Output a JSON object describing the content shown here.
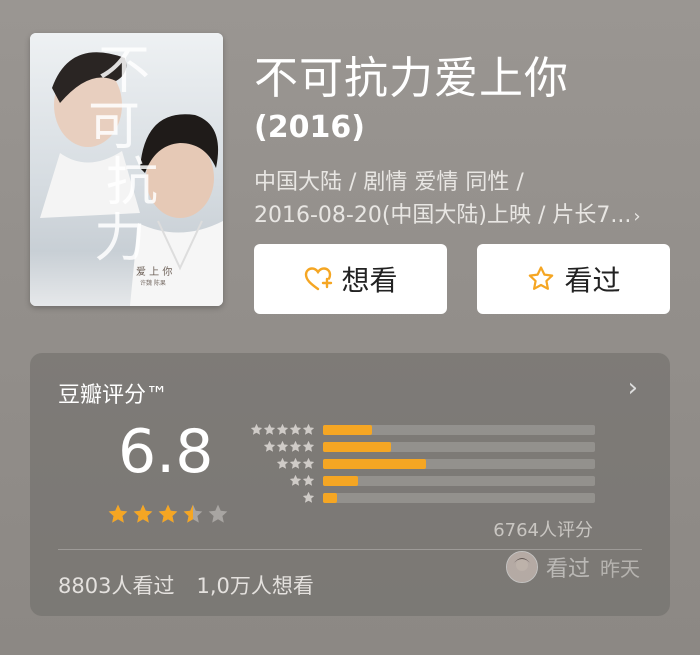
{
  "movie": {
    "title": "不可抗力爱上你",
    "year": "(2016)",
    "meta_line1": "中国大陆 / 剧情 爱情 同性 /",
    "meta_line2": "2016-08-20(中国大陆)上映 / 片长7...",
    "meta_chevron": "›",
    "poster": {
      "calligraphy": [
        "不",
        "可",
        "抗",
        "力"
      ],
      "subtitle": "爱 上 你",
      "credits": "许魏 陈果"
    }
  },
  "actions": {
    "want_label": "想看",
    "want_icon": "heart-plus-icon",
    "seen_label": "看过",
    "seen_icon": "star-outline-icon"
  },
  "rating": {
    "title": "豆瓣评分™",
    "score": "6.8",
    "stars": 3.5,
    "distribution": [
      {
        "stars": 5,
        "fraction": 0.18
      },
      {
        "stars": 4,
        "fraction": 0.25
      },
      {
        "stars": 3,
        "fraction": 0.38
      },
      {
        "stars": 2,
        "fraction": 0.13
      },
      {
        "stars": 1,
        "fraction": 0.05
      }
    ],
    "count_label": "6764人评分",
    "chevron": "›"
  },
  "friend_activity": {
    "label": "看过",
    "when": "昨天"
  },
  "stats": {
    "seen": "8803人看过",
    "want": "1,0万人想看"
  },
  "colors": {
    "accent": "#f5a623",
    "background": "#948f8b"
  }
}
